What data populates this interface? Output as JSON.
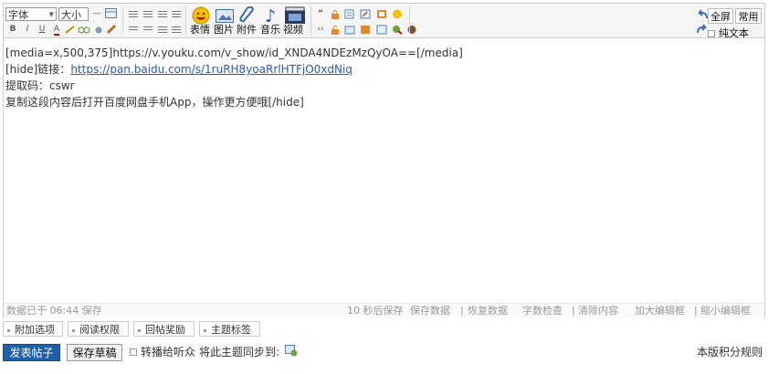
{
  "toolbar": {
    "font_select": "字体",
    "size_select": "大小",
    "emoji_label": "表情",
    "image_label": "图片",
    "attach_label": "附件",
    "music_label": "音乐",
    "video_label": "视频",
    "fullscreen_label": "全屏",
    "common_label": "常用",
    "plaintext_label": "纯文本"
  },
  "content": {
    "line1": "[media=x,500,375]https://v.youku.com/v_show/id_XNDA4NDEzMzQyOA==[/media]",
    "line2_prefix": "[hide]链接：",
    "line2_link": "https://pan.baidu.com/s/1ruRH8yoaRrlHTFjO0xdNiq",
    "line3": "提取码：cswr",
    "line4": "复制这段内容后打开百度网盘手机App，操作更方便哦[/hide]"
  },
  "status": {
    "saved": "数据已于 06:44 保存",
    "autosave": "10 秒后保存",
    "save": "保存数据",
    "restore": "恢复数据",
    "wordcount": "字数检查",
    "clear": "清除内容",
    "enlarge": "加大编辑框",
    "shrink": "缩小编辑框"
  },
  "options": {
    "extra": "附加选项",
    "readperm": "阅读权限",
    "reward": "回帖奖励",
    "tags": "主题标签"
  },
  "post": {
    "submit": "发表帖子",
    "draft": "保存草稿",
    "broadcast": "转播给听众",
    "sync": "将此主题同步到:",
    "rules": "本版积分规则"
  }
}
